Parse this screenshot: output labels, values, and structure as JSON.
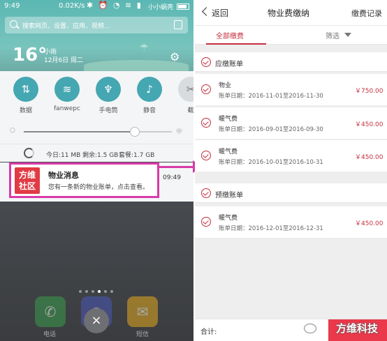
{
  "left": {
    "status": {
      "time": "9:49",
      "rate": "0.02K/s",
      "carrier": "小小蜗壳"
    },
    "search": {
      "placeholder": "搜索网页、设置、应用、视频..."
    },
    "weather": {
      "temperature": "16°",
      "condition": "小雨",
      "date": "12月6日 周二"
    },
    "toggles": [
      {
        "label": "数据",
        "icon": "data-arrows-icon",
        "on": true
      },
      {
        "label": "fanwepc",
        "icon": "wifi-icon",
        "on": true
      },
      {
        "label": "手电筒",
        "icon": "flashlight-icon",
        "on": true
      },
      {
        "label": "静音",
        "icon": "bell-mute-icon",
        "on": true
      },
      {
        "label": "截",
        "icon": "screenshot-icon",
        "on": false
      }
    ],
    "data_usage": {
      "today": "今日:11 MB",
      "remaining": "剩余:1.5 GB",
      "plan": "套餐:1.7 GB"
    },
    "notification": {
      "app_logo_line1": "方维",
      "app_logo_line2": "社区",
      "title": "物业消息",
      "body": "您有一条新的物业账单，点击查看。",
      "time": "09:49"
    },
    "dock": [
      {
        "label": "电话",
        "icon": "phone-icon"
      },
      {
        "label": "",
        "icon": "camera-icon"
      },
      {
        "label": "短信",
        "icon": "message-icon"
      }
    ],
    "dismiss_icon": "×"
  },
  "right": {
    "nav": {
      "back_label": "返回",
      "title": "物业费缴纳",
      "record_label": "缴费记录"
    },
    "tabs": {
      "all_label": "全部缴费",
      "filter_label": "筛选"
    },
    "payable": {
      "title": "应缴账单",
      "bills": [
        {
          "name": "物业",
          "date": "账单日期：2016-11-01至2016-11-30",
          "amount": "￥750.00"
        },
        {
          "name": "暖气费",
          "date": "账单日期：2016-09-01至2016-09-30",
          "amount": "￥450.00"
        },
        {
          "name": "暖气费",
          "date": "账单日期：2016-10-01至2016-10-31",
          "amount": "￥450.00"
        }
      ]
    },
    "prepay": {
      "title": "预缴账单",
      "bills": [
        {
          "name": "暖气费",
          "date": "账单日期：2016-12-01至2016-12-31",
          "amount": "￥450.00"
        }
      ]
    },
    "footer": {
      "total_label": "合计:",
      "pay_label": ""
    },
    "watermark": {
      "text": "方维科技"
    }
  },
  "colors": {
    "accent": "#c4303e",
    "highlight": "#d83aa8",
    "toggle_on": "#45a7b2",
    "pay_button": "#e9394b"
  }
}
